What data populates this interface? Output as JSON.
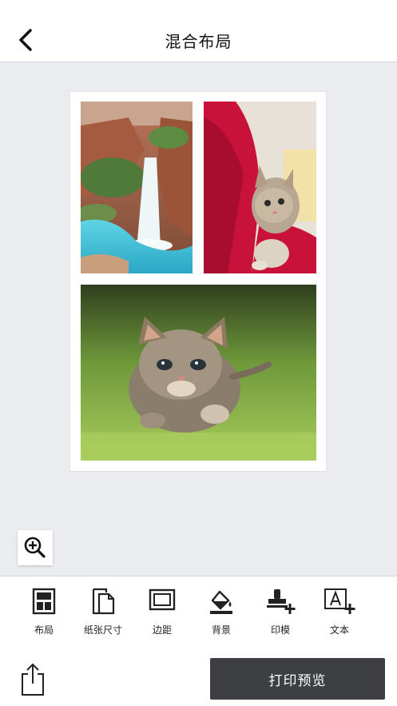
{
  "header": {
    "title": "混合布局",
    "back_icon": "chevron-left-icon"
  },
  "canvas": {
    "background_color": "#ebecef",
    "photos": [
      {
        "subject": "waterfall",
        "icon": "image"
      },
      {
        "subject": "cat-on-red-chair",
        "icon": "image"
      },
      {
        "subject": "kitten-on-grass",
        "icon": "image"
      }
    ],
    "zoom_icon": "zoom-in-icon"
  },
  "toolbar": {
    "items": [
      {
        "label": "布局",
        "icon": "layout-icon"
      },
      {
        "label": "纸张尺寸",
        "icon": "paper-size-icon"
      },
      {
        "label": "边距",
        "icon": "margin-icon"
      },
      {
        "label": "背景",
        "icon": "background-fill-icon"
      },
      {
        "label": "印模",
        "icon": "stamp-add-icon"
      },
      {
        "label": "文本",
        "icon": "text-add-icon"
      }
    ]
  },
  "bottom": {
    "share_icon": "share-icon",
    "preview_label": "打印预览",
    "preview_color": "#3e3f43"
  }
}
